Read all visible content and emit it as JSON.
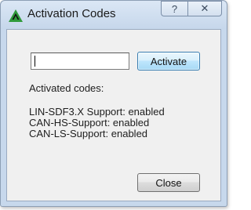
{
  "window": {
    "title": "Activation Codes",
    "help_glyph": "?",
    "close_glyph": "✕"
  },
  "form": {
    "code_value": "",
    "activate_label": "Activate"
  },
  "codes": {
    "heading": "Activated codes:",
    "items": [
      "LIN-SDF3.X Support: enabled",
      "CAN-HS-Support: enabled",
      "CAN-LS-Support: enabled"
    ]
  },
  "footer": {
    "close_label": "Close"
  },
  "icons": {
    "app": "activation-app-icon",
    "help": "help-icon",
    "close": "close-icon"
  },
  "colors": {
    "frame": "#c7d8ec",
    "client": "#f0f0f0",
    "accent_button_border": "#3c7fb1",
    "app_icon_green": "#2f9a3a"
  }
}
